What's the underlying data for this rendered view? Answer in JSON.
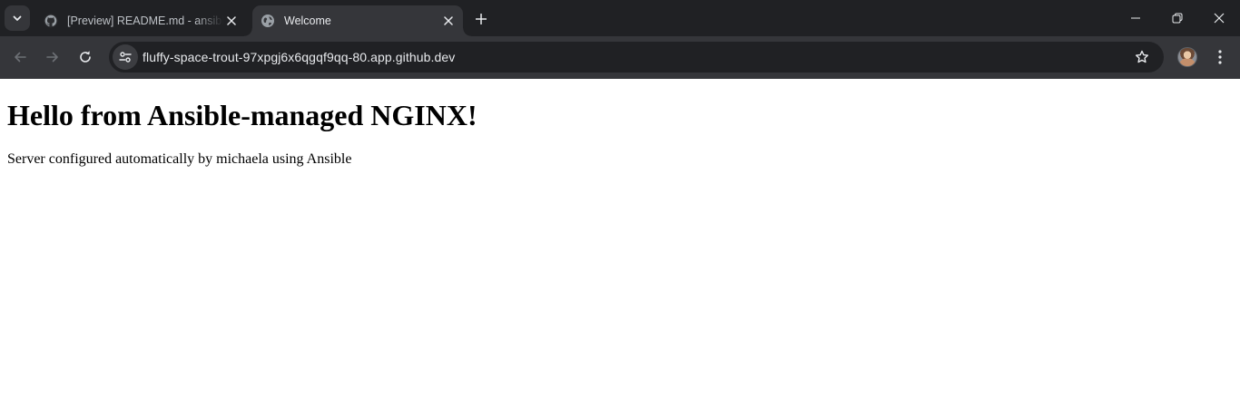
{
  "browser": {
    "tabs": [
      {
        "title": "[Preview] README.md - ansible",
        "icon": "github-icon",
        "active": false
      },
      {
        "title": "Welcome",
        "icon": "globe-icon",
        "active": true
      }
    ],
    "address_bar": {
      "url": "fluffy-space-trout-97xpgj6x6qgqf9qq-80.app.github.dev"
    },
    "colors": {
      "tabstrip_bg": "#202124",
      "toolbar_bg": "#35363a",
      "text": "#e8eaed"
    }
  },
  "page": {
    "heading": "Hello from Ansible-managed NGINX!",
    "paragraph": "Server configured automatically by michaela using Ansible"
  }
}
